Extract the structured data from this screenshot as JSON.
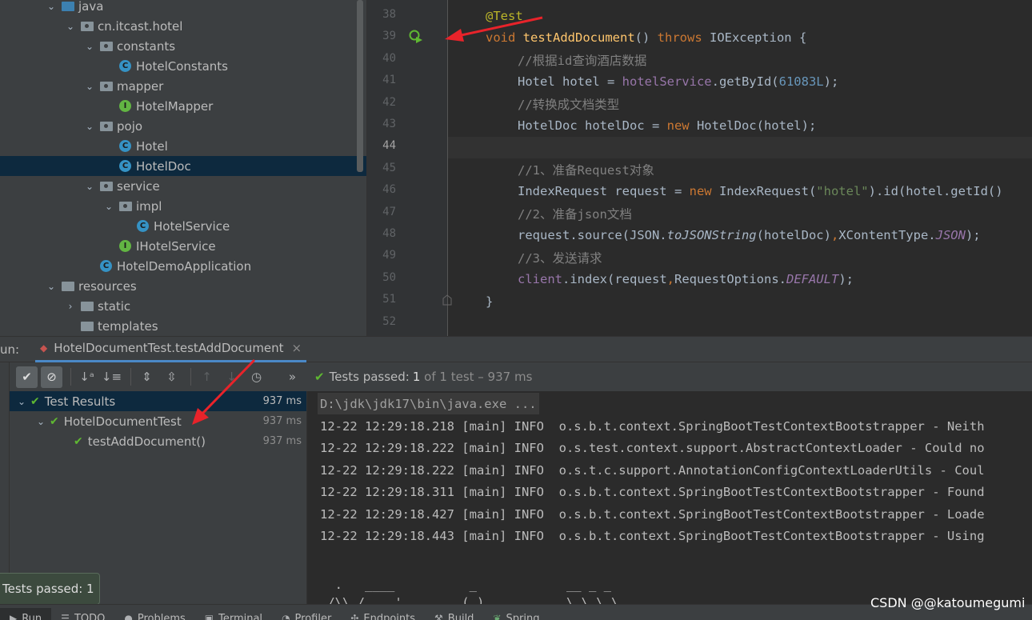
{
  "project_tree": [
    {
      "label": "java",
      "indent": 1,
      "arrow": "down",
      "icon": "folder-blue-icon"
    },
    {
      "label": "cn.itcast.hotel",
      "indent": 2,
      "arrow": "down",
      "icon": "package-icon"
    },
    {
      "label": "constants",
      "indent": 3,
      "arrow": "down",
      "icon": "package-icon"
    },
    {
      "label": "HotelConstants",
      "indent": 4,
      "arrow": "",
      "icon": "class-icon"
    },
    {
      "label": "mapper",
      "indent": 3,
      "arrow": "down",
      "icon": "package-icon"
    },
    {
      "label": "HotelMapper",
      "indent": 4,
      "arrow": "",
      "icon": "interface-icon"
    },
    {
      "label": "pojo",
      "indent": 3,
      "arrow": "down",
      "icon": "package-icon"
    },
    {
      "label": "Hotel",
      "indent": 4,
      "arrow": "",
      "icon": "class-icon"
    },
    {
      "label": "HotelDoc",
      "indent": 4,
      "arrow": "",
      "icon": "class-icon",
      "selected": true
    },
    {
      "label": "service",
      "indent": 3,
      "arrow": "down",
      "icon": "package-icon"
    },
    {
      "label": "impl",
      "indent": 4,
      "arrow": "down",
      "icon": "package-icon"
    },
    {
      "label": "HotelService",
      "indent": 5,
      "arrow": "",
      "icon": "class-icon"
    },
    {
      "label": "IHotelService",
      "indent": 4,
      "arrow": "",
      "icon": "interface-icon"
    },
    {
      "label": "HotelDemoApplication",
      "indent": 3,
      "arrow": "",
      "icon": "spring-class-icon"
    },
    {
      "label": "resources",
      "indent": 1,
      "arrow": "down",
      "icon": "resources-folder-icon"
    },
    {
      "label": "static",
      "indent": 2,
      "arrow": "right",
      "icon": "folder-icon"
    },
    {
      "label": "templates",
      "indent": 2,
      "arrow": "",
      "icon": "folder-icon"
    }
  ],
  "editor": {
    "line_numbers": [
      "38",
      "39",
      "40",
      "41",
      "42",
      "43",
      "44",
      "45",
      "46",
      "47",
      "48",
      "49",
      "50",
      "51",
      "52"
    ],
    "current_line": "44"
  },
  "code": {
    "l38_ann": "@Test",
    "l39_kw1": "void ",
    "l39_fn": "testAddDocument",
    "l39_p": "() ",
    "l39_kw2": "throws ",
    "l39_rest": "IOException {",
    "l40_cmt": "//根据id查询酒店数据",
    "l41_a": "Hotel hotel = ",
    "l41_fld": "hotelService",
    "l41_b": ".getById(",
    "l41_num": "61083L",
    "l41_c": ");",
    "l42_cmt": "//转换成文档类型",
    "l43_a": "HotelDoc hotelDoc = ",
    "l43_kw": "new ",
    "l43_b": "HotelDoc(hotel);",
    "l45_cmt": "//1、准备Request对象",
    "l46_a": "IndexRequest request = ",
    "l46_kw": "new ",
    "l46_b": "IndexRequest(",
    "l46_str": "\"hotel\"",
    "l46_c": ").id(hotel.getId()",
    "l47_cmt": "//2、准备json文档",
    "l48_a": "request.source(JSON.",
    "l48_it": "toJSONString",
    "l48_b": "(hotelDoc)",
    "l48_comma": ",",
    "l48_c": "XContentType.",
    "l48_fld": "JSON",
    "l48_d": ");",
    "l49_cmt": "//3、发送请求",
    "l50_fld": "client",
    "l50_a": ".index(request",
    "l50_comma": ",",
    "l50_b": "RequestOptions.",
    "l50_fld2": "DEFAULT",
    "l50_c": ");",
    "l51": "}"
  },
  "run": {
    "label": "un:",
    "tab_title": "HotelDocumentTest.testAddDocument",
    "close": "×"
  },
  "toolbar": {
    "passed_prefix": "Tests passed: ",
    "passed_count": "1",
    "passed_suffix": " of 1 test – 937 ms",
    "more": "»"
  },
  "tests": [
    {
      "label": "Test Results",
      "time": "937 ms",
      "selected": true
    },
    {
      "label": "HotelDocumentTest",
      "time": "937 ms"
    },
    {
      "label": "testAddDocument()",
      "time": "937 ms"
    }
  ],
  "console": {
    "cmd": "D:\\jdk\\jdk17\\bin\\java.exe ...",
    "lines": [
      "12-22 12:29:18.218 [main] INFO  o.s.b.t.context.SpringBootTestContextBootstrapper - Neith",
      "12-22 12:29:18.222 [main] INFO  o.s.test.context.support.AbstractContextLoader - Could no",
      "12-22 12:29:18.222 [main] INFO  o.s.t.c.support.AnnotationConfigContextLoaderUtils - Coul",
      "12-22 12:29:18.311 [main] INFO  o.s.b.t.context.SpringBootTestContextBootstrapper - Found",
      "12-22 12:29:18.427 [main] INFO  o.s.b.t.context.SpringBootTestContextBootstrapper - Loade",
      "12-22 12:29:18.443 [main] INFO  o.s.b.t.context.SpringBootTestContextBootstrapper - Using"
    ],
    "banner1": "  .   ____          _            __ _ _",
    "banner2": " /\\\\ / ___'_ __ _ _(_)_ __  __ _ \\ \\ \\ \\"
  },
  "tooltip": "Tests passed: 1",
  "bottom_tabs": [
    {
      "label": "Run",
      "icon": "run-icon",
      "active": true
    },
    {
      "label": "TODO",
      "icon": "todo-icon"
    },
    {
      "label": "Problems",
      "icon": "problems-icon"
    },
    {
      "label": "Terminal",
      "icon": "terminal-icon"
    },
    {
      "label": "Profiler",
      "icon": "profiler-icon"
    },
    {
      "label": "Endpoints",
      "icon": "endpoints-icon"
    },
    {
      "label": "Build",
      "icon": "build-icon"
    },
    {
      "label": "Spring",
      "icon": "spring-icon"
    }
  ],
  "watermark": "CSDN @@katoumegumi",
  "colors": {
    "accent_red_arrow": "#e8232a",
    "passed_green": "#5fb832",
    "selection_blue": "#0d293e"
  }
}
